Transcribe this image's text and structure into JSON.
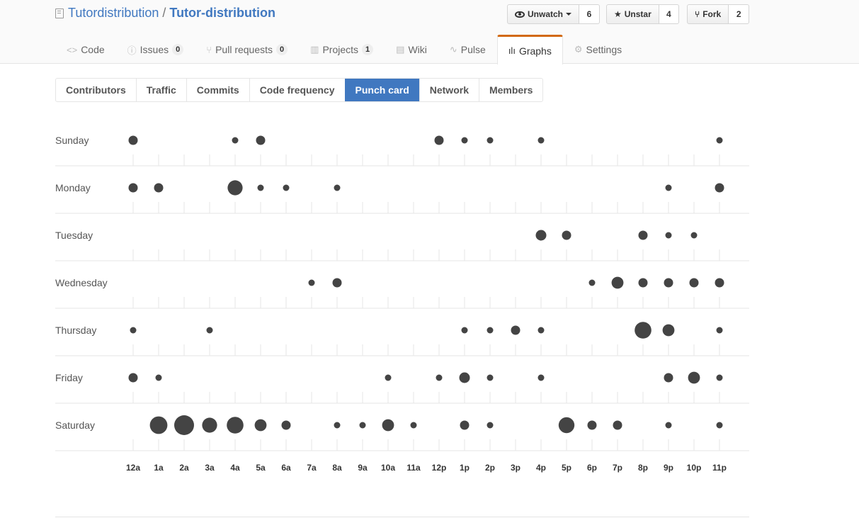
{
  "repo": {
    "owner": "Tutordistribution",
    "separator": "/",
    "name": "Tutor-distribution"
  },
  "actions": [
    {
      "label": "Unwatch",
      "count": "6",
      "icon": "eye-icon",
      "has_caret": true
    },
    {
      "label": "Unstar",
      "count": "4",
      "icon": "star-icon",
      "has_caret": false
    },
    {
      "label": "Fork",
      "count": "2",
      "icon": "fork-icon",
      "has_caret": false
    }
  ],
  "reponav": [
    {
      "label": "Code",
      "icon": "code-icon",
      "glyph": "<>",
      "counter": null,
      "selected": false
    },
    {
      "label": "Issues",
      "icon": "issue-icon",
      "glyph": "ⓘ",
      "counter": "0",
      "selected": false
    },
    {
      "label": "Pull requests",
      "icon": "pull-request-icon",
      "glyph": "⑂",
      "counter": "0",
      "selected": false
    },
    {
      "label": "Projects",
      "icon": "project-icon",
      "glyph": "▥",
      "counter": "1",
      "selected": false
    },
    {
      "label": "Wiki",
      "icon": "book-icon",
      "glyph": "▤",
      "counter": null,
      "selected": false
    },
    {
      "label": "Pulse",
      "icon": "pulse-icon",
      "glyph": "∿",
      "counter": null,
      "selected": false
    },
    {
      "label": "Graphs",
      "icon": "graph-icon",
      "glyph": "ılı",
      "counter": null,
      "selected": true
    },
    {
      "label": "Settings",
      "icon": "gear-icon",
      "glyph": "⚙",
      "counter": null,
      "selected": false
    }
  ],
  "subnav": [
    {
      "label": "Contributors",
      "selected": false
    },
    {
      "label": "Traffic",
      "selected": false
    },
    {
      "label": "Commits",
      "selected": false
    },
    {
      "label": "Code frequency",
      "selected": false
    },
    {
      "label": "Punch card",
      "selected": true
    },
    {
      "label": "Network",
      "selected": false
    },
    {
      "label": "Members",
      "selected": false
    }
  ],
  "colors": {
    "accent": "#4078c0",
    "tab_highlight": "#d26911",
    "dot": "#444444",
    "rule": "#e5e5e5"
  },
  "chart_data": {
    "type": "scatter",
    "days": [
      "Sunday",
      "Monday",
      "Tuesday",
      "Wednesday",
      "Thursday",
      "Friday",
      "Saturday"
    ],
    "hours": [
      "12a",
      "1a",
      "2a",
      "3a",
      "4a",
      "5a",
      "6a",
      "7a",
      "8a",
      "9a",
      "10a",
      "11a",
      "12p",
      "1p",
      "2p",
      "3p",
      "4p",
      "5p",
      "6p",
      "7p",
      "8p",
      "9p",
      "10p",
      "11p"
    ],
    "values": [
      [
        3,
        0,
        0,
        0,
        1,
        3,
        0,
        0,
        0,
        0,
        0,
        0,
        3,
        1,
        1,
        0,
        1,
        0,
        0,
        0,
        0,
        0,
        0,
        1
      ],
      [
        3,
        3,
        0,
        0,
        8,
        1,
        1,
        0,
        1,
        0,
        0,
        0,
        0,
        0,
        0,
        0,
        0,
        0,
        0,
        0,
        0,
        1,
        0,
        3
      ],
      [
        0,
        0,
        0,
        0,
        0,
        0,
        0,
        0,
        0,
        0,
        0,
        0,
        0,
        0,
        0,
        0,
        4,
        3,
        0,
        0,
        3,
        1,
        1,
        0
      ],
      [
        0,
        0,
        0,
        0,
        0,
        0,
        0,
        1,
        3,
        0,
        0,
        0,
        0,
        0,
        0,
        0,
        0,
        0,
        1,
        5,
        3,
        3,
        3,
        3
      ],
      [
        1,
        0,
        0,
        1,
        0,
        0,
        0,
        0,
        0,
        0,
        0,
        0,
        0,
        1,
        1,
        3,
        1,
        0,
        0,
        0,
        10,
        5,
        0,
        1
      ],
      [
        3,
        1,
        0,
        0,
        0,
        0,
        0,
        0,
        0,
        0,
        1,
        0,
        1,
        4,
        1,
        0,
        1,
        0,
        0,
        0,
        0,
        3,
        5,
        1
      ],
      [
        0,
        11,
        14,
        8,
        10,
        5,
        3,
        0,
        1,
        1,
        5,
        1,
        0,
        3,
        1,
        0,
        0,
        9,
        3,
        3,
        0,
        1,
        0,
        1
      ]
    ]
  }
}
